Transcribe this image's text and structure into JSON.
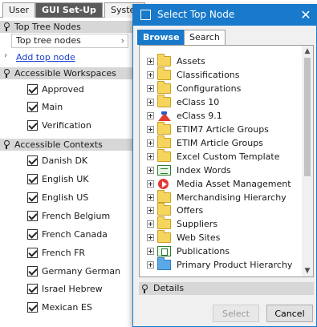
{
  "background_panel": {
    "tabs": [
      "User",
      "GUI Set-Up",
      "Syster"
    ],
    "top_tree_nodes": {
      "header": "Top Tree Nodes",
      "field_value": "Top tree nodes",
      "add_link": "Add top node"
    },
    "accessible_workspaces": {
      "header": "Accessible Workspaces",
      "items": [
        "Approved",
        "Main",
        "Verification"
      ]
    },
    "accessible_contexts": {
      "header": "Accessible Contexts",
      "items": [
        "Danish DK",
        "English UK",
        "English US",
        "French Belgium",
        "French Canada",
        "French FR",
        "Germany German",
        "Israel Hebrew",
        "Mexican ES"
      ]
    }
  },
  "dialog": {
    "title": "Select Top Node",
    "tabs": [
      "Browse",
      "Search"
    ],
    "active_tab": "Browse",
    "tree": [
      {
        "label": "Assets",
        "icon": "folder-icon"
      },
      {
        "label": "Classifications",
        "icon": "folder-icon"
      },
      {
        "label": "Configurations",
        "icon": "folder-icon"
      },
      {
        "label": "eClass 10",
        "icon": "folder-icon"
      },
      {
        "label": "eClass 9.1",
        "icon": "eclass-icon"
      },
      {
        "label": "ETIM7 Article Groups",
        "icon": "folder-icon"
      },
      {
        "label": "ETIM Article Groups",
        "icon": "folder-icon"
      },
      {
        "label": "Excel Custom Template",
        "icon": "folder-icon"
      },
      {
        "label": "Index Words",
        "icon": "index-words-icon"
      },
      {
        "label": "Media Asset Management",
        "icon": "media-asset-icon"
      },
      {
        "label": "Merchandising Hierarchy",
        "icon": "folder-icon"
      },
      {
        "label": "Offers",
        "icon": "folder-icon"
      },
      {
        "label": "Suppliers",
        "icon": "folder-icon"
      },
      {
        "label": "Web Sites",
        "icon": "folder-icon"
      },
      {
        "label": "Publications",
        "icon": "publications-icon"
      },
      {
        "label": "Primary Product Hierarchy",
        "icon": "blue-folder-icon"
      }
    ],
    "details_label": "Details",
    "buttons": {
      "select": "Select",
      "cancel": "Cancel"
    }
  },
  "colors": {
    "accent_blue": "#1979ca",
    "section_header_gray": "#d7d7d7",
    "link_blue": "#1a3ecc"
  }
}
